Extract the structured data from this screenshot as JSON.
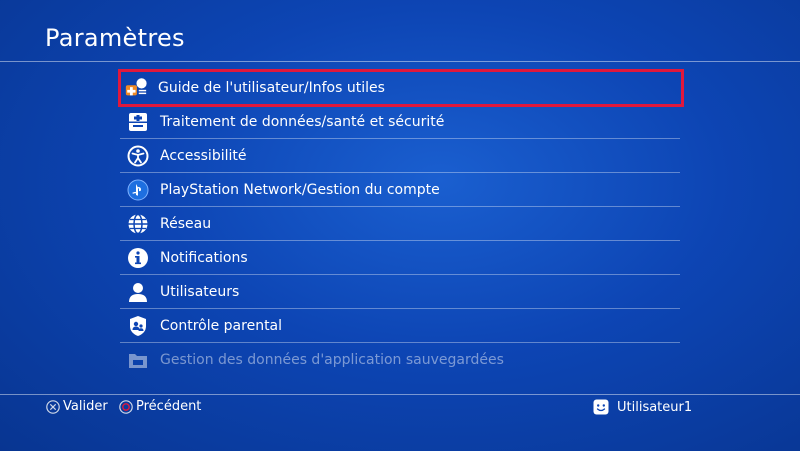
{
  "header": {
    "title": "Paramètres"
  },
  "menu": {
    "items": [
      {
        "label": "Guide de l'utilisateur/Infos utiles",
        "icon": "user-guide-icon",
        "selected": true
      },
      {
        "label": "Traitement de données/santé et sécurité",
        "icon": "health-safety-icon"
      },
      {
        "label": "Accessibilité",
        "icon": "accessibility-icon"
      },
      {
        "label": "PlayStation Network/Gestion du compte",
        "icon": "playstation-network-icon"
      },
      {
        "label": "Réseau",
        "icon": "network-globe-icon"
      },
      {
        "label": "Notifications",
        "icon": "info-icon"
      },
      {
        "label": "Utilisateurs",
        "icon": "user-icon"
      },
      {
        "label": "Contrôle parental",
        "icon": "parental-control-icon"
      },
      {
        "label": "Gestion des données d'application sauvegardées",
        "icon": "saved-data-icon"
      }
    ]
  },
  "footer": {
    "confirm_label": "Valider",
    "confirm_icon": "cross-button-icon",
    "back_label": "Précédent",
    "back_icon": "circle-button-icon",
    "user_label": "Utilisateur1",
    "user_icon": "user-avatar-icon"
  },
  "colors": {
    "background": "#0d45b4",
    "selection_border": "#e0183c",
    "text": "#ffffff"
  }
}
